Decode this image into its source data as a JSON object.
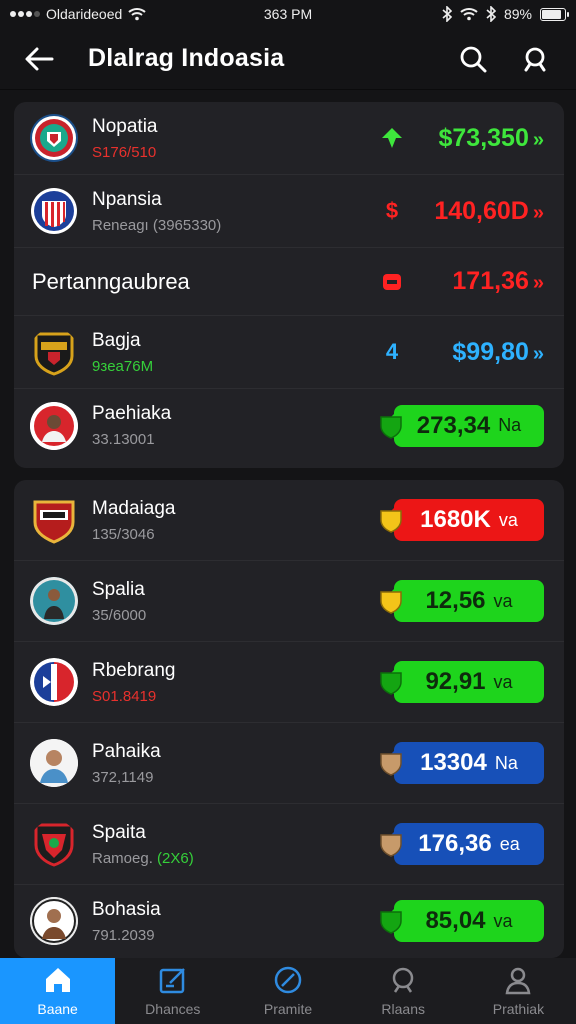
{
  "status_bar": {
    "carrier": "Oldarideoed",
    "time": "363 PM",
    "battery_text": "89%",
    "battery_level": 0.89
  },
  "header": {
    "title": "Dlalrag Indoasia",
    "back_icon": "back-arrow-icon",
    "search_icon": "search-icon",
    "notify_icon": "search-icon"
  },
  "list1": {
    "rows": [
      {
        "name": "Nopatia",
        "sub": "S176/510",
        "value": "$73,350",
        "suffix": "»",
        "color": "#3ee63c"
      },
      {
        "name": "Npansia",
        "sub": "Reneagı (3965330)",
        "value": "140,60D",
        "suffix": "»",
        "color": "#ff2222"
      },
      {
        "section": "Pertanngaubrea",
        "value": "171,36",
        "suffix": "»",
        "color": "#ff2222"
      },
      {
        "name": "Bagja",
        "sub": "9зea76M",
        "value": "$99,80",
        "suffix": "»",
        "color": "#2eb2ff"
      },
      {
        "name": "Paehiaka",
        "sub": "33.13001",
        "value": "273,34",
        "unit": "Na",
        "pill": "green"
      }
    ]
  },
  "list2": {
    "rows": [
      {
        "name": "Madaiaga",
        "sub": "135/3046",
        "value": "1680K",
        "unit": "va",
        "pill": "red"
      },
      {
        "name": "Spalia",
        "sub": "35/6000",
        "value": "12,56",
        "unit": "va",
        "pill": "green"
      },
      {
        "name": "Rbebrang",
        "sub": "S01.8419",
        "value": "92,91",
        "unit": "va",
        "pill": "green"
      },
      {
        "name": "Pahaika",
        "sub": "372,1149",
        "value": "13304",
        "unit": "Na",
        "pill": "blue"
      },
      {
        "name": "Spaita",
        "sub": "Ramoeg.",
        "sub_hl": "(2X6)",
        "value": "176,36",
        "unit": "ea",
        "pill": "blue"
      },
      {
        "name": "Bohasia",
        "sub": "791.2039",
        "value": "85,04",
        "unit": "va",
        "pill": "green"
      }
    ]
  },
  "bottom_nav": {
    "items": [
      {
        "label": "Baane",
        "icon": "home-icon",
        "active": true
      },
      {
        "label": "Dhances",
        "icon": "edit-icon"
      },
      {
        "label": "Pramite",
        "icon": "compass-icon"
      },
      {
        "label": "Rlaans",
        "icon": "search-icon"
      },
      {
        "label": "Prathiak",
        "icon": "profile-icon"
      }
    ]
  }
}
